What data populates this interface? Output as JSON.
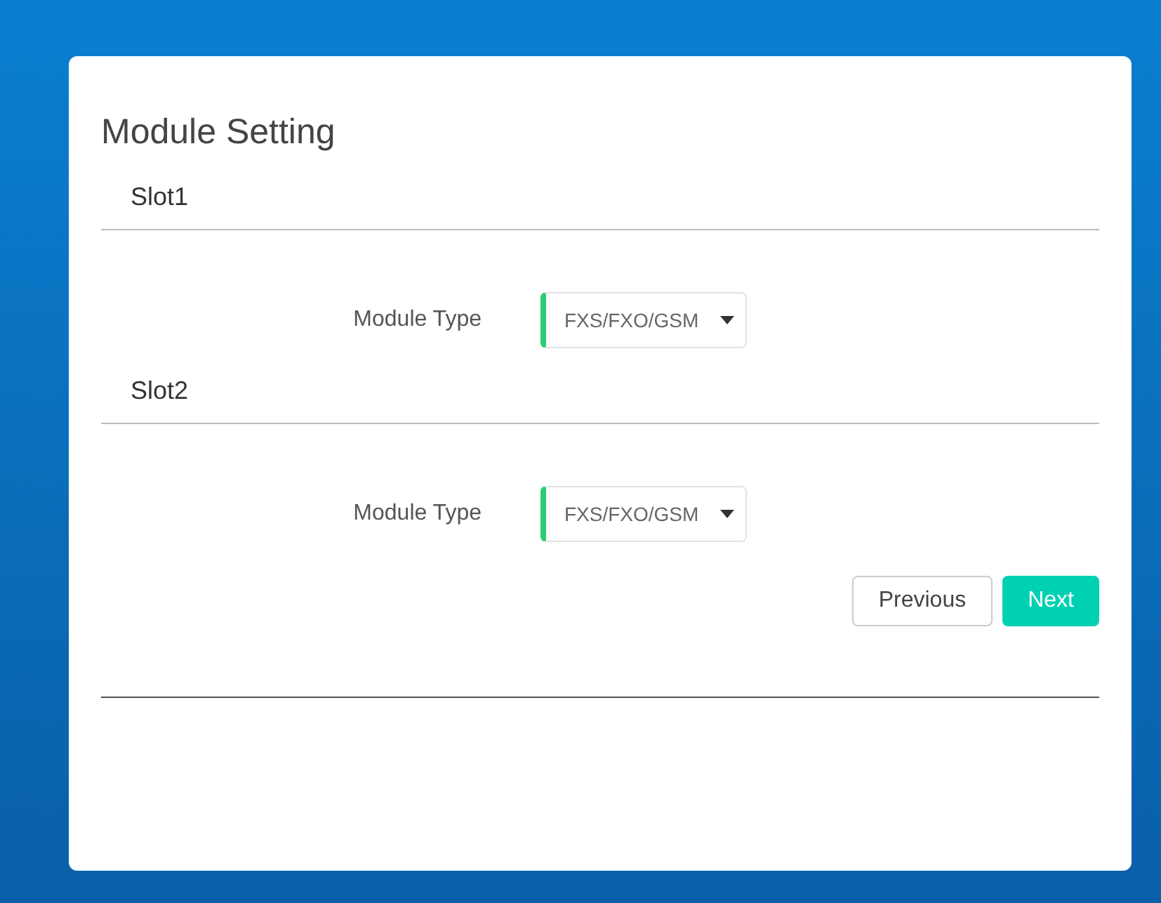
{
  "title": "Module Setting",
  "slots": [
    {
      "name": "Slot1",
      "field_label": "Module Type",
      "value": "FXS/FXO/GSM"
    },
    {
      "name": "Slot2",
      "field_label": "Module Type",
      "value": "FXS/FXO/GSM"
    }
  ],
  "buttons": [
    {
      "label": "Previous",
      "kind": "secondary"
    },
    {
      "label": "Next",
      "kind": "primary"
    }
  ]
}
